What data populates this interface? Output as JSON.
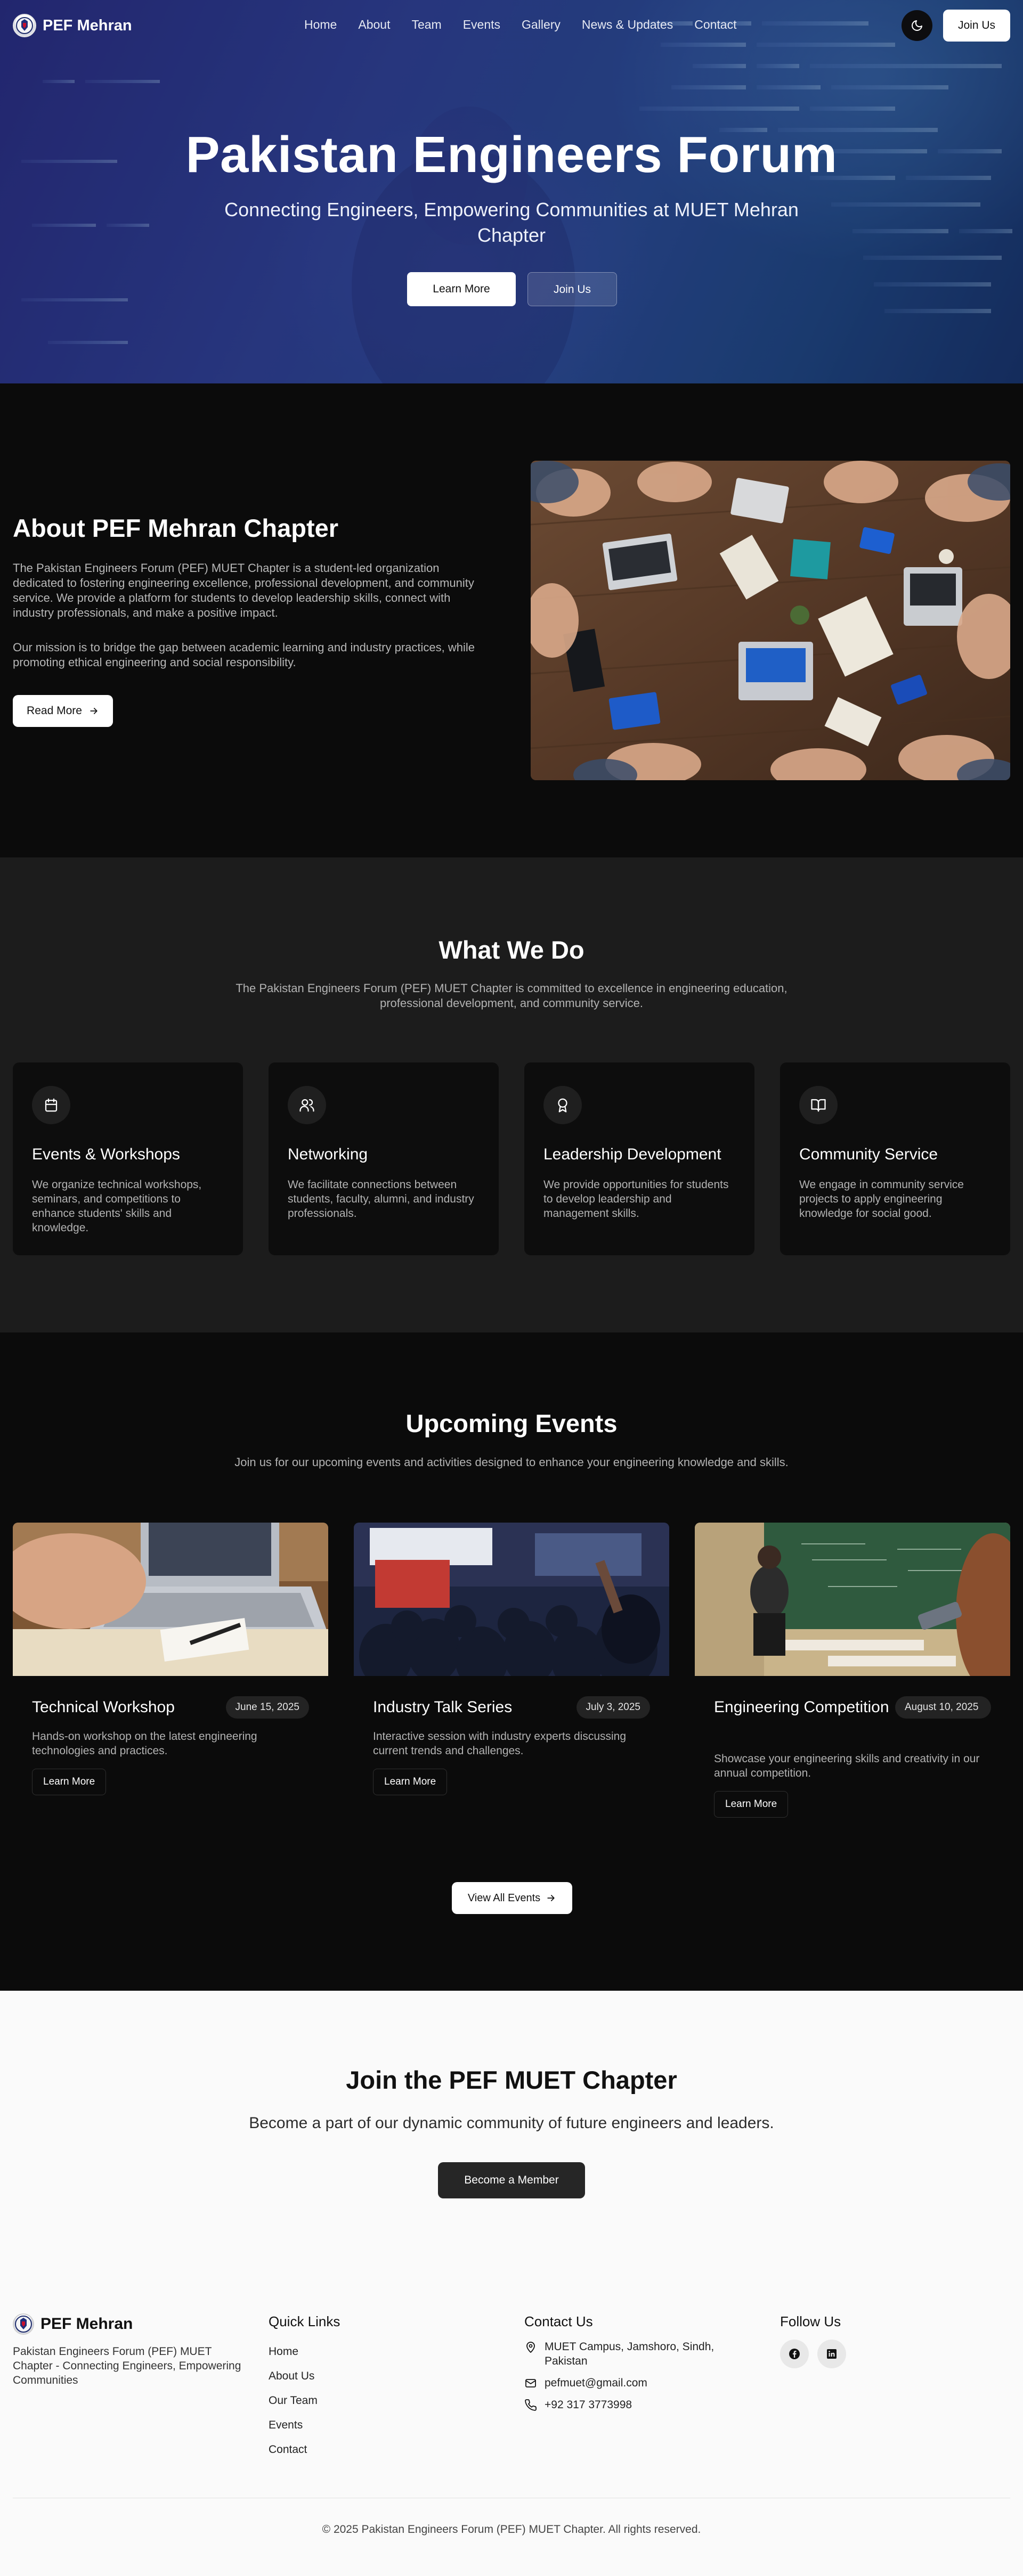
{
  "brand": {
    "name": "PEF Mehran"
  },
  "nav": {
    "links": [
      "Home",
      "About",
      "Team",
      "Events",
      "Gallery",
      "News & Updates",
      "Contact"
    ],
    "theme_icon": "moon-icon",
    "join_label": "Join Us"
  },
  "hero": {
    "title": "Pakistan Engineers Forum",
    "subtitle": "Connecting Engineers, Empowering Communities at MUET Mehran Chapter",
    "primary_label": "Learn More",
    "secondary_label": "Join Us"
  },
  "about": {
    "title": "About PEF Mehran Chapter",
    "paragraph1": "The Pakistan Engineers Forum (PEF) MUET Chapter is a student-led organization dedicated to fostering engineering excellence, professional development, and community service. We provide a platform for students to develop leadership skills, connect with industry professionals, and make a positive impact.",
    "paragraph2": "Our mission is to bridge the gap between academic learning and industry practices, while promoting ethical engineering and social responsibility.",
    "read_more_label": "Read More"
  },
  "what_we_do": {
    "title": "What We Do",
    "description": "The Pakistan Engineers Forum (PEF) MUET Chapter is committed to excellence in engineering education, professional development, and community service.",
    "cards": [
      {
        "icon": "calendar-icon",
        "title": "Events & Workshops",
        "text": "We organize technical workshops, seminars, and competitions to enhance students' skills and knowledge."
      },
      {
        "icon": "users-icon",
        "title": "Networking",
        "text": "We facilitate connections between students, faculty, alumni, and industry professionals."
      },
      {
        "icon": "award-icon",
        "title": "Leadership Development",
        "text": "We provide opportunities for students to develop leadership and management skills."
      },
      {
        "icon": "book-open-icon",
        "title": "Community Service",
        "text": "We engage in community service projects to apply engineering knowledge for social good."
      }
    ]
  },
  "events": {
    "title": "Upcoming Events",
    "description": "Join us for our upcoming events and activities designed to enhance your engineering knowledge and skills.",
    "items": [
      {
        "title": "Technical Workshop",
        "date": "June 15, 2025",
        "description": "Hands-on workshop on the latest engineering technologies and practices.",
        "button": "Learn More"
      },
      {
        "title": "Industry Talk Series",
        "date": "July 3, 2025",
        "description": "Interactive session with industry experts discussing current trends and challenges.",
        "button": "Learn More"
      },
      {
        "title": "Engineering Competition",
        "date": "August 10, 2025",
        "description": "Showcase your engineering skills and creativity in our annual competition.",
        "button": "Learn More"
      }
    ],
    "view_all_label": "View All Events"
  },
  "join": {
    "title": "Join the PEF MUET Chapter",
    "subtitle": "Become a part of our dynamic community of future engineers and leaders.",
    "button": "Become a Member"
  },
  "footer": {
    "brand_name": "PEF Mehran",
    "tagline": "Pakistan Engineers Forum (PEF) MUET Chapter - Connecting Engineers, Empowering Communities",
    "quick_links_title": "Quick Links",
    "quick_links": [
      "Home",
      "About Us",
      "Our Team",
      "Events",
      "Contact"
    ],
    "contact_title": "Contact Us",
    "address": "MUET Campus, Jamshoro, Sindh, Pakistan",
    "email": "pefmuet@gmail.com",
    "phone": "+92 317 3773998",
    "follow_title": "Follow Us",
    "social_icons": [
      "facebook-icon",
      "linkedin-icon"
    ],
    "copyright": "© 2025 Pakistan Engineers Forum (PEF) MUET Chapter. All rights reserved."
  }
}
